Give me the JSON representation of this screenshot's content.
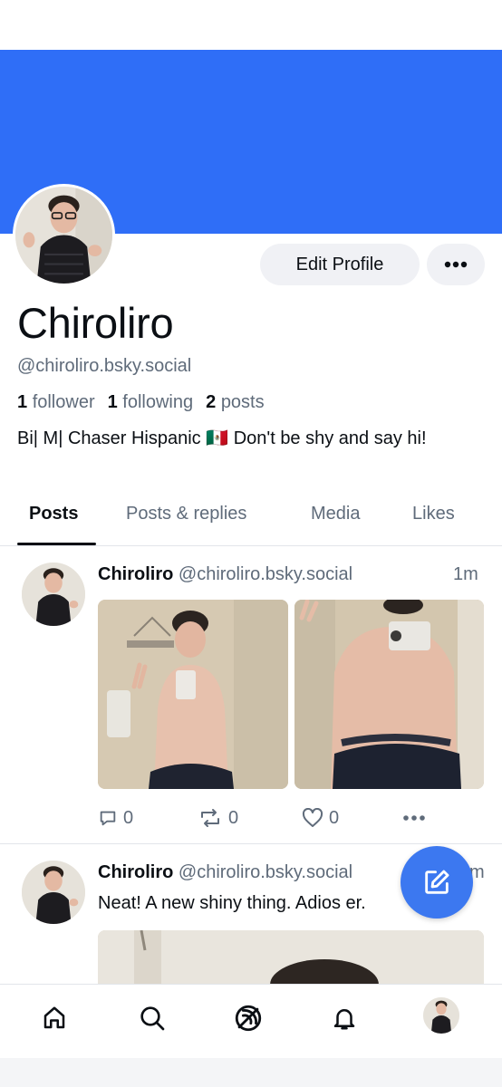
{
  "colors": {
    "banner": "#2f6ef7",
    "accent": "#3c78f0",
    "text_primary": "#0b0f14",
    "text_secondary": "#5f6b7a",
    "button_bg": "#f0f1f5"
  },
  "profile": {
    "display_name": "Chiroliro",
    "handle": "@chiroliro.bsky.social",
    "followers_count": "1",
    "followers_label": "follower",
    "following_count": "1",
    "following_label": "following",
    "posts_count": "2",
    "posts_label": "posts",
    "bio": "Bi| M| Chaser Hispanic 🇲🇽 Don't be shy and say hi!",
    "edit_button": "Edit Profile",
    "more_icon": "ellipsis-icon"
  },
  "tabs": [
    {
      "label": "Posts",
      "active": true
    },
    {
      "label": "Posts & replies",
      "active": false
    },
    {
      "label": "Media",
      "active": false
    },
    {
      "label": "Likes",
      "active": false
    }
  ],
  "posts": [
    {
      "author": "Chiroliro",
      "handle": "@chiroliro.bsky.social",
      "time": "1m",
      "text": "",
      "image_count": 2,
      "replies": "0",
      "reposts": "0",
      "likes": "0"
    },
    {
      "author": "Chiroliro",
      "handle": "@chiroliro.bsky.social",
      "time": "m",
      "text": "Neat! A new shiny thing. Adios          er.",
      "image_count": 1
    }
  ],
  "fab": {
    "icon": "compose-icon"
  },
  "bottom_nav": [
    {
      "name": "home",
      "icon": "home-icon"
    },
    {
      "name": "search",
      "icon": "search-icon"
    },
    {
      "name": "feeds",
      "icon": "feeds-icon"
    },
    {
      "name": "notifications",
      "icon": "bell-icon"
    },
    {
      "name": "profile",
      "icon": "avatar"
    }
  ]
}
